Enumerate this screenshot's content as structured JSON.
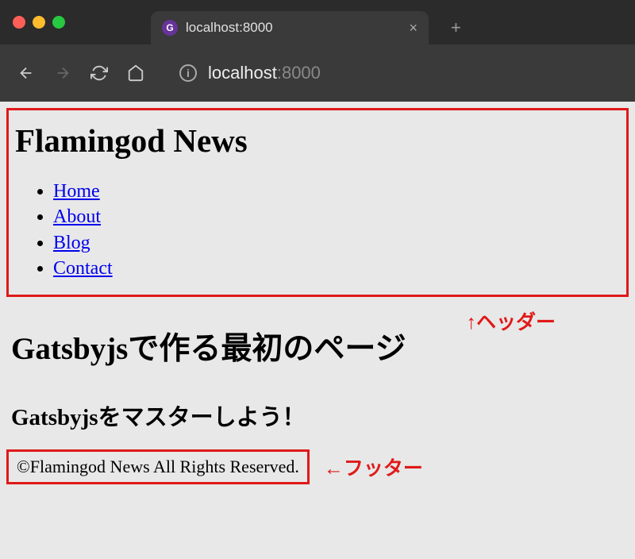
{
  "browser": {
    "tab_title": "localhost:8000",
    "url_host": "localhost",
    "url_port": ":8000",
    "new_tab": "+",
    "close_tab": "×"
  },
  "header": {
    "site_title": "Flamingod News",
    "nav": [
      {
        "label": "Home"
      },
      {
        "label": "About"
      },
      {
        "label": "Blog"
      },
      {
        "label": "Contact"
      }
    ]
  },
  "annotations": {
    "header": "↑ヘッダー",
    "footer": "←フッター"
  },
  "main": {
    "title": "Gatsbyjsで作る最初のページ",
    "subtitle": "Gatsbyjsをマスターしよう！"
  },
  "footer": {
    "copyright": "©Flamingod News All Rights Reserved."
  }
}
